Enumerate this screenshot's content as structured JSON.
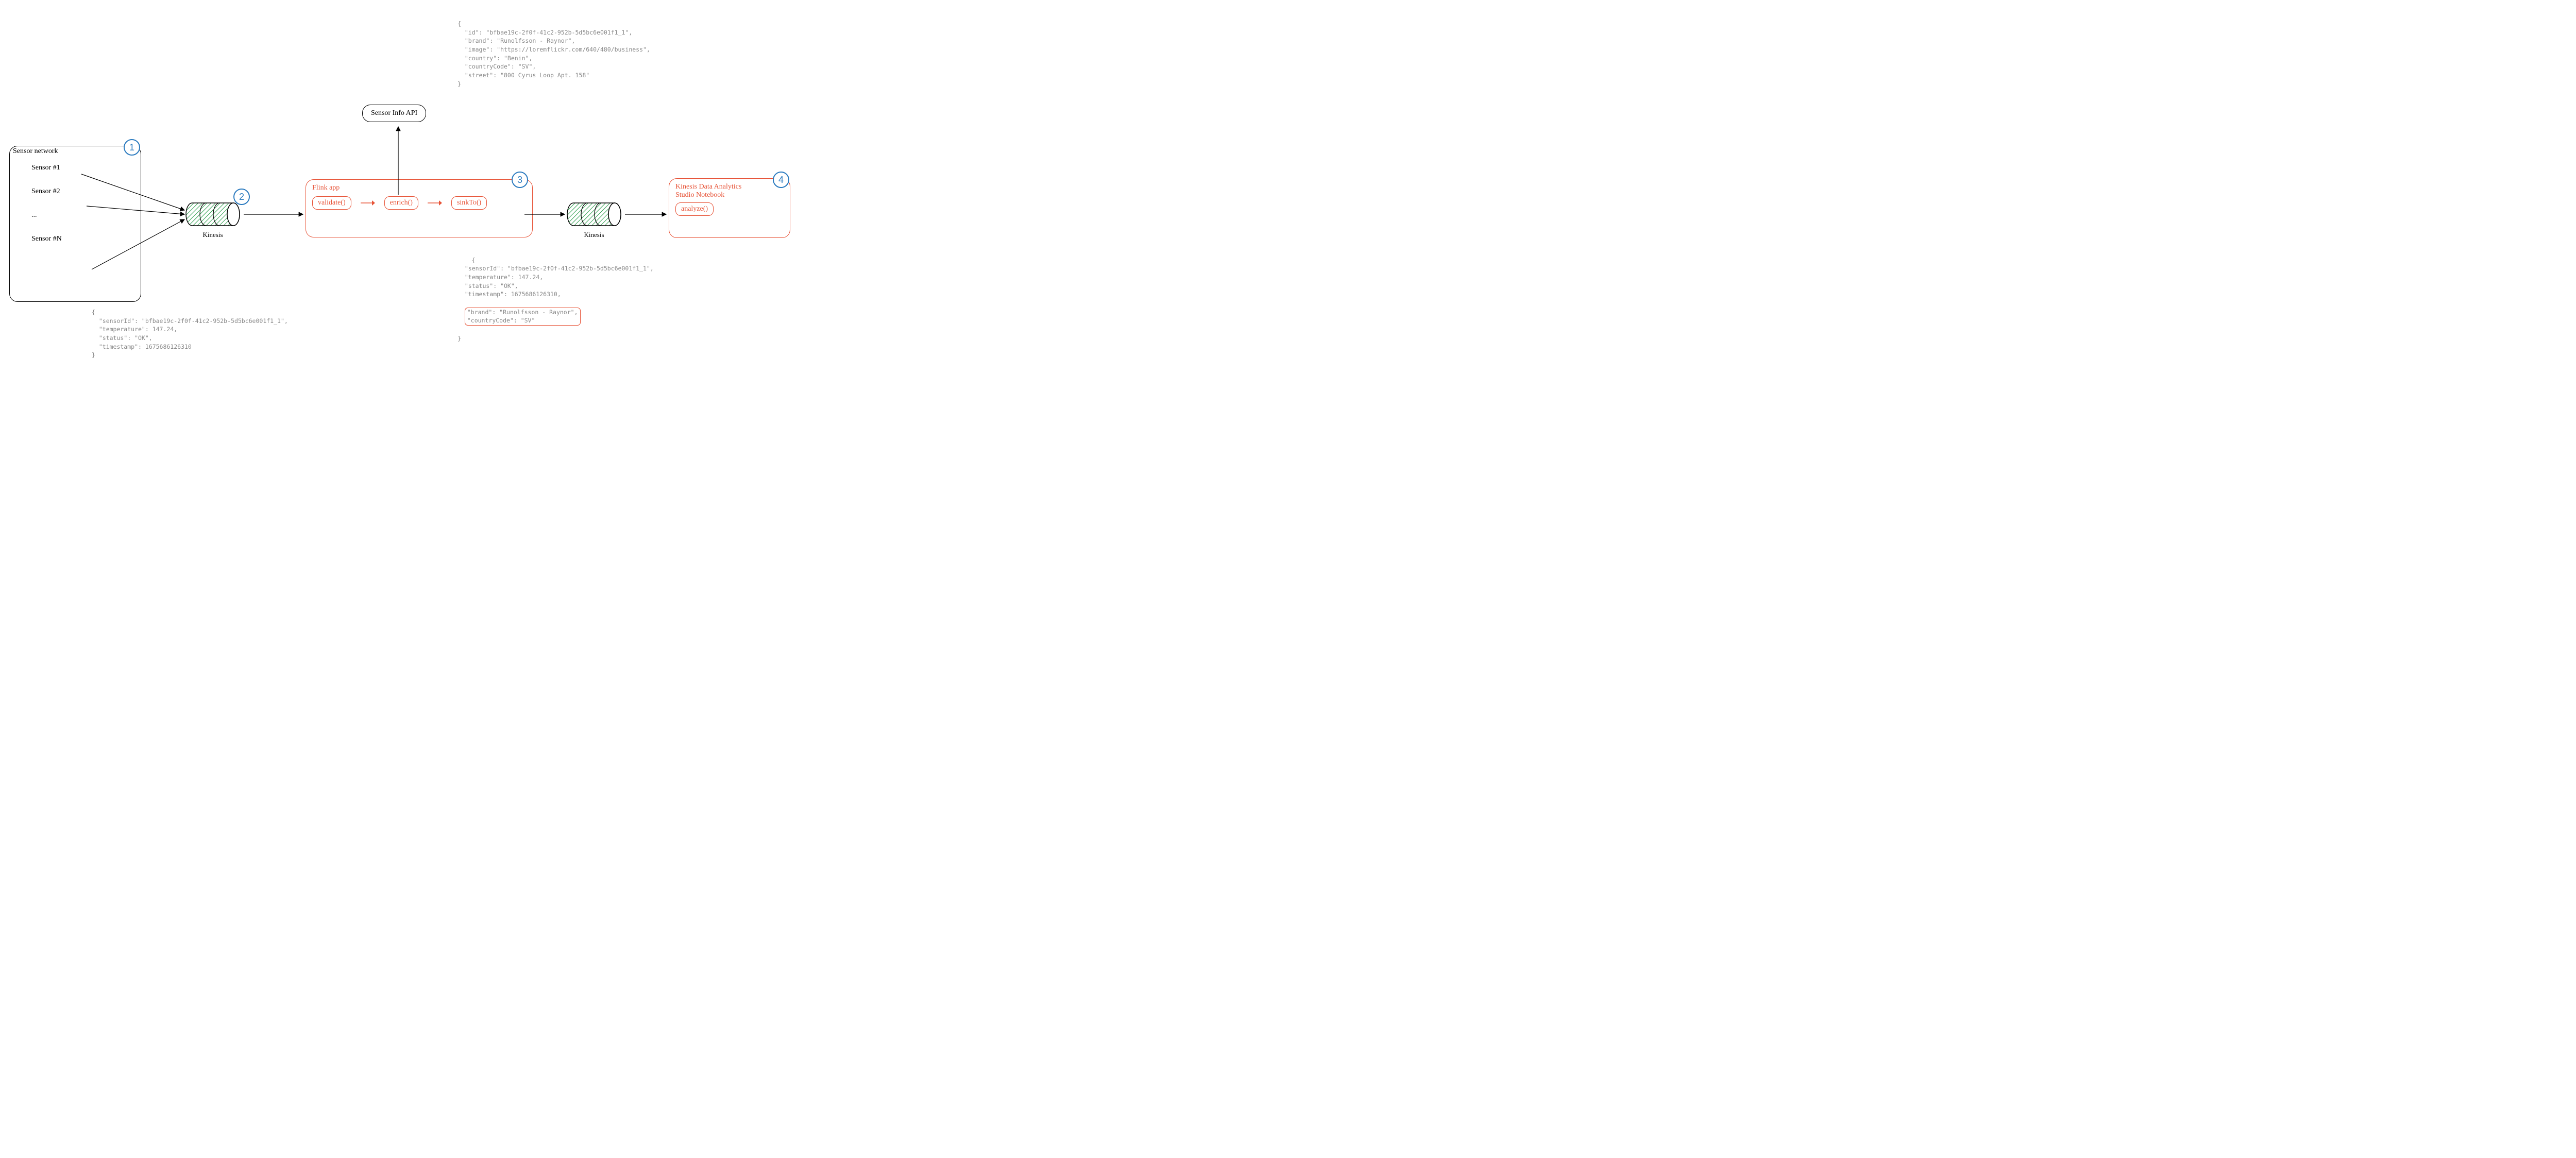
{
  "steps": {
    "n1": "1",
    "n2": "2",
    "n3": "3",
    "n4": "4"
  },
  "sensorNetwork": {
    "title": "Sensor network",
    "items": [
      "Sensor #1",
      "Sensor #2",
      "...",
      "Sensor #N"
    ]
  },
  "kinesis1": "Kinesis",
  "kinesis2": "Kinesis",
  "sensorInfoApi": "Sensor Info API",
  "flinkApp": {
    "title": "Flink app",
    "steps": {
      "validate": "validate()",
      "enrich": "enrich()",
      "sinkTo": "sinkTo()"
    }
  },
  "notebook": {
    "title": "Kinesis Data Analytics\nStudio Notebook",
    "step": "analyze()"
  },
  "jsonSensorReading": "{\n  \"sensorId\": \"bfbae19c-2f0f-41c2-952b-5d5bc6e001f1_1\",\n  \"temperature\": 147.24,\n  \"status\": \"OK\",\n  \"timestamp\": 1675686126310\n}",
  "jsonSensorInfo": "{\n  \"id\": \"bfbae19c-2f0f-41c2-952b-5d5bc6e001f1_1\",\n  \"brand\": \"Runolfsson - Raynor\",\n  \"image\": \"https://loremflickr.com/640/480/business\",\n  \"country\": \"Benin\",\n  \"countryCode\": \"SV\",\n  \"street\": \"800 Cyrus Loop Apt. 158\"\n}",
  "jsonEnrichedTop": "{\n  \"sensorId\": \"bfbae19c-2f0f-41c2-952b-5d5bc6e001f1_1\",\n  \"temperature\": 147.24,\n  \"status\": \"OK\",\n  \"timestamp\": 1675686126310,",
  "jsonEnrichedHighlight": "\"brand\": \"Runolfsson - Raynor\",\n\"countryCode\": \"SV\"",
  "jsonEnrichedBottom": "}"
}
